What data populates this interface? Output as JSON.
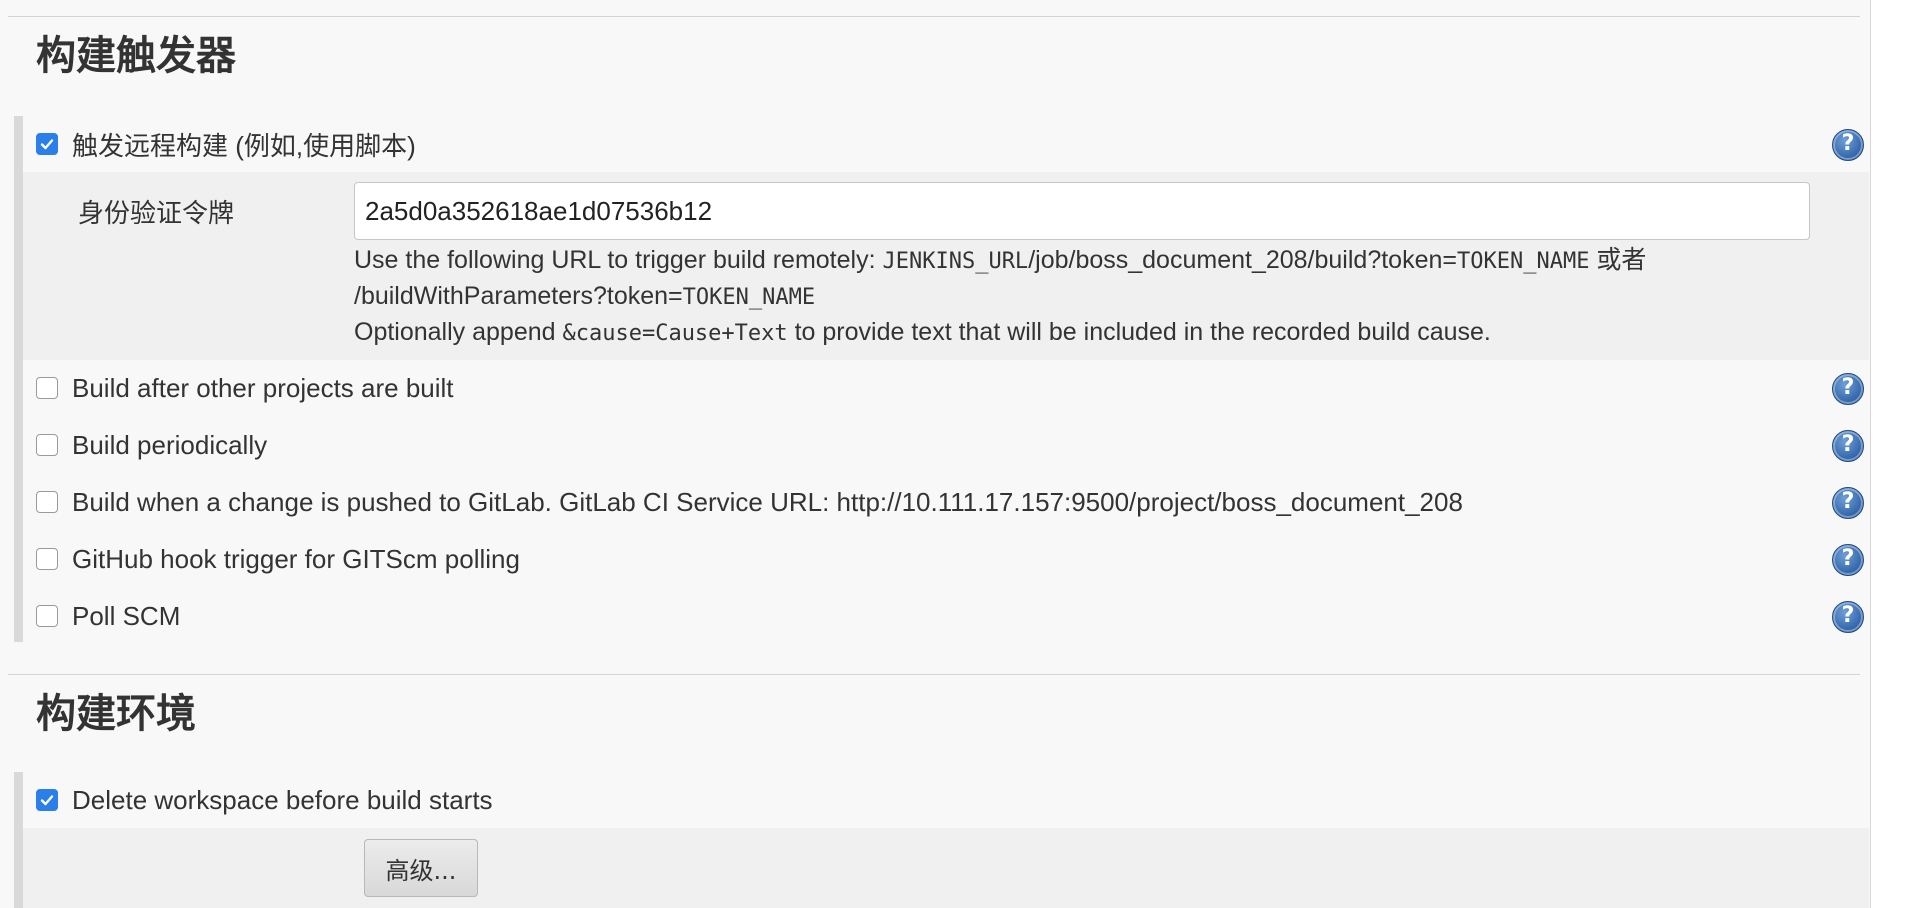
{
  "build_triggers": {
    "title": "构建触发器",
    "remote_trigger": {
      "label": "触发远程构建 (例如,使用脚本)",
      "checked": true,
      "token_label": "身份验证令牌",
      "token_value": "2a5d0a352618ae1d07536b12",
      "help_line1_prefix": "Use the following URL to trigger build remotely: ",
      "help_line1_code1": "JENKINS_URL",
      "help_line1_mid": "/job/boss_document_208/build?token=",
      "help_line1_code2": "TOKEN_NAME",
      "help_line1_suffix": " 或者",
      "help_line2_prefix": "/buildWithParameters?token=",
      "help_line2_code": "TOKEN_NAME",
      "help_line3_prefix": "Optionally append ",
      "help_line3_code": "&cause=Cause+Text",
      "help_line3_suffix": " to provide text that will be included in the recorded build cause."
    },
    "options": [
      {
        "label": "Build after other projects are built",
        "checked": false
      },
      {
        "label": "Build periodically",
        "checked": false
      },
      {
        "label": "Build when a change is pushed to GitLab. GitLab CI Service URL: http://10.111.17.157:9500/project/boss_document_208",
        "checked": false
      },
      {
        "label": "GitHub hook trigger for GITScm polling",
        "checked": false
      },
      {
        "label": "Poll SCM",
        "checked": false
      }
    ]
  },
  "build_environment": {
    "title": "构建环境",
    "delete_workspace": {
      "label": "Delete workspace before build starts",
      "checked": true
    },
    "advanced_button": "高级..."
  },
  "help_icon_glyph": "?",
  "colors": {
    "checkbox_checked": "#2b7fe8",
    "help_icon": "#2f63a8",
    "panel_bg": "#f8f8f8",
    "sub_panel_bg": "#f0f0f0",
    "group_bar": "#d9d9d9"
  }
}
